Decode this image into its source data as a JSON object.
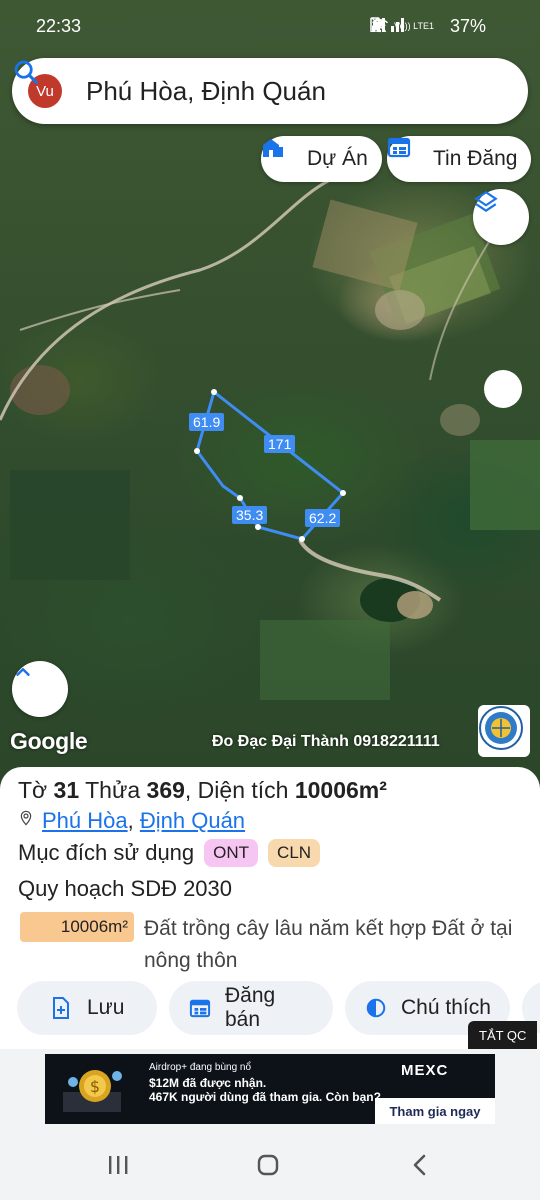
{
  "status_bar": {
    "time": "22:33",
    "network": "Vo)) LTE1",
    "battery": "37%"
  },
  "search": {
    "avatar_initials": "Vu",
    "query": "Phú Hòa, Định Quán"
  },
  "chips": [
    {
      "label": "Dự Án",
      "icon": "building-icon"
    },
    {
      "label": "Tin Đăng",
      "icon": "listing-icon"
    }
  ],
  "map": {
    "edge_labels": [
      "61.9",
      "171",
      "35.3",
      "62.2"
    ],
    "google_label": "Google",
    "credit": "Đo Đạc Đại Thành 0918221111",
    "accent": "#3f8cf2"
  },
  "parcel": {
    "sheet_prefix": "Tờ",
    "sheet": "31",
    "lot_prefix": "Thửa",
    "lot": "369",
    "area_prefix": ", Diện tích",
    "area": "10006m²",
    "ward": "Phú Hòa",
    "district": "Định Quán",
    "purpose_label": "Mục đích sử dụng",
    "purpose_tags": [
      "ONT",
      "CLN"
    ],
    "planning_label": "Quy hoạch SDĐ 2030",
    "planning_area": "10006m²",
    "planning_desc": "Đất trồng cây lâu năm kết hợp Đất ở tại nông thôn"
  },
  "actions": [
    {
      "label": "Lưu",
      "icon": "save-icon"
    },
    {
      "label": "Đăng bán",
      "icon": "listing-icon"
    },
    {
      "label": "Chú thích",
      "icon": "legend-icon"
    }
  ],
  "ad": {
    "close_label": "TẮT QC",
    "line1": "Airdrop+ đang bùng nổ",
    "line2": "$12M đã được nhận.",
    "line3": "467K người dùng đã tham gia. Còn bạn?",
    "brand": "MEXC",
    "cta": "Tham gia ngay"
  }
}
